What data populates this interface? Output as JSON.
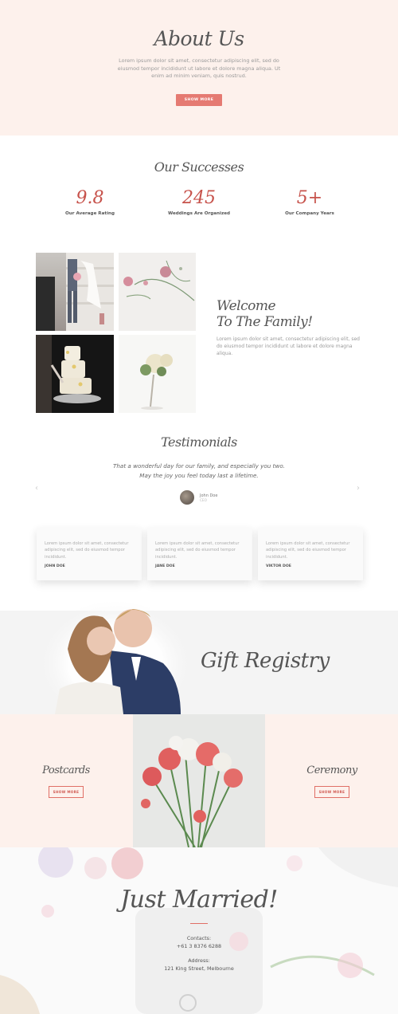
{
  "about": {
    "title": "About Us",
    "text": "Lorem ipsum dolor sit amet, consectetur adipiscing elit, sed do eiusmod tempor incididunt ut labore et dolore magna aliqua. Ut enim ad minim veniam, quis nostrud.",
    "button": "SHOW MORE"
  },
  "successes": {
    "title": "Our Successes",
    "stats": [
      {
        "value": "9.8",
        "label": "Our Average Rating"
      },
      {
        "value": "245",
        "label": "Weddings Are Organized"
      },
      {
        "value": "5+",
        "label": "Our Company Years"
      }
    ]
  },
  "welcome": {
    "title_line1": "Welcome",
    "title_line2": "To The Family!",
    "text": "Lorem ipsum dolor sit amet, consectetur adipiscing elit, sed do eiusmod tempor incididunt ut labore et dolore magna aliqua."
  },
  "testimonials": {
    "title": "Testimonials",
    "quote_line1": "That a wonderful day for our family, and especially you two.",
    "quote_line2": "May the joy you feel today last a lifetime.",
    "author": "John Doe",
    "author_role": "CEO",
    "prev_arrow": "‹",
    "next_arrow": "›"
  },
  "cards": [
    {
      "text": "Lorem ipsum dolor sit amet, consectetur adipiscing elit, sed do eiusmod tempor incididunt.",
      "name": "JOHN DOE"
    },
    {
      "text": "Lorem ipsum dolor sit amet, consectetur adipiscing elit, sed do eiusmod tempor incididunt.",
      "name": "JANE DOE"
    },
    {
      "text": "Lorem ipsum dolor sit amet, consectetur adipiscing elit, sed do eiusmod tempor incididunt.",
      "name": "VIKTOR DOE"
    }
  ],
  "gift": {
    "title": "Gift Registry"
  },
  "postcards": {
    "title": "Postcards",
    "button": "SHOW MORE"
  },
  "ceremony": {
    "title": "Ceremony",
    "button": "SHOW MORE"
  },
  "footer": {
    "title": "Just Married!",
    "contacts_label": "Contacts:",
    "phone": "+61 3 8376 6288",
    "address_label": "Address:",
    "address": "121 King Street, Melbourne"
  },
  "colors": {
    "accent": "#e57a72",
    "pink_bg": "#fdf1ec",
    "number": "#c7534c"
  }
}
